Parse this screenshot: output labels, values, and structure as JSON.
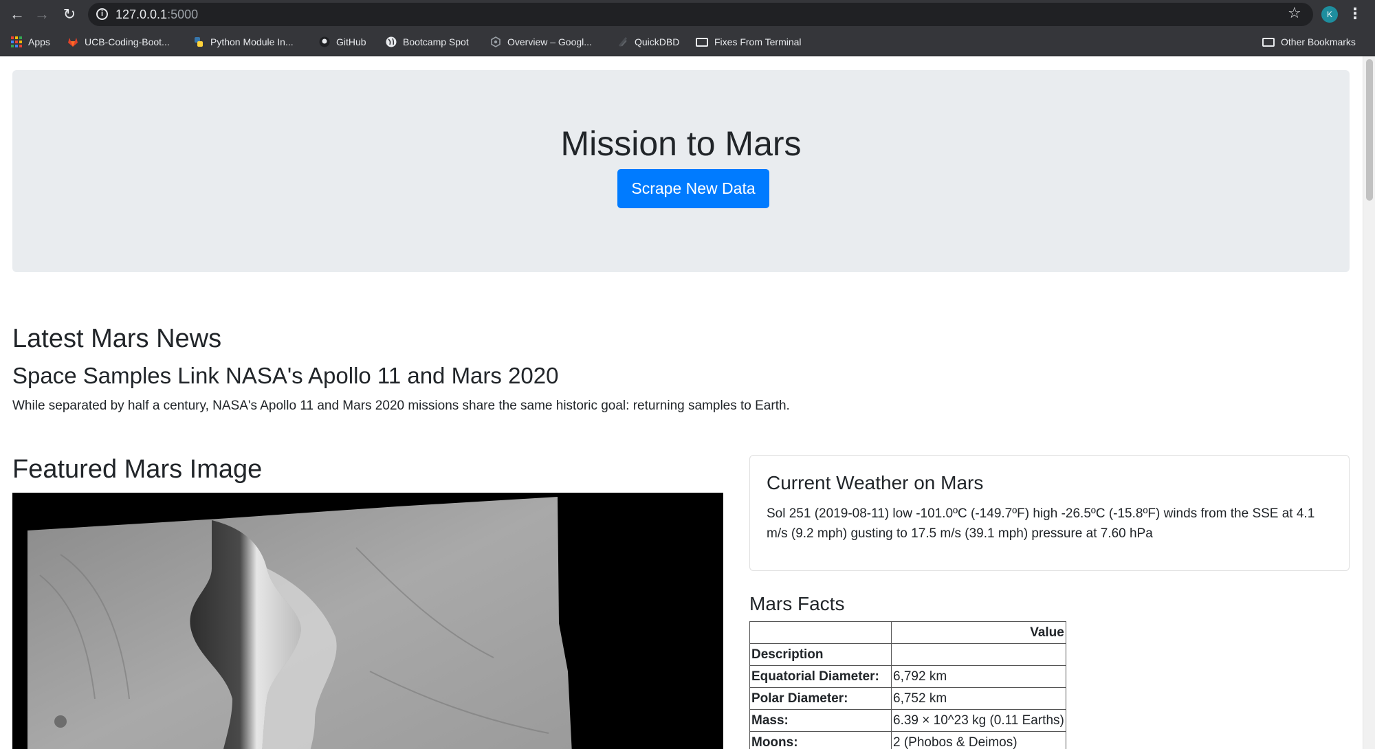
{
  "browser": {
    "url_host": "127.0.0.1",
    "url_port": ":5000",
    "avatar_initial": "K",
    "bookmarks": [
      {
        "label": "Apps",
        "icon": "apps-grid-icon"
      },
      {
        "label": "UCB-Coding-Boot...",
        "icon": "gitlab-icon"
      },
      {
        "label": "Python Module In...",
        "icon": "python-icon"
      },
      {
        "label": "GitHub",
        "icon": "github-icon"
      },
      {
        "label": "Bootcamp Spot",
        "icon": "globe-icon"
      },
      {
        "label": "Overview – Googl...",
        "icon": "google-cloud-icon"
      },
      {
        "label": "QuickDBD",
        "icon": "quickdbd-icon"
      },
      {
        "label": "Fixes From Terminal",
        "icon": "folder-icon"
      }
    ],
    "other_bookmarks": "Other Bookmarks"
  },
  "hero": {
    "title": "Mission to Mars",
    "button_label": "Scrape New Data",
    "button_color": "#007bff",
    "background_color": "#e9ecef"
  },
  "news": {
    "heading": "Latest Mars News",
    "title": "Space Samples Link NASA's Apollo 11 and Mars 2020",
    "teaser": "While separated by half a century, NASA's Apollo 11 and Mars 2020 missions share the same historic goal: returning samples to Earth."
  },
  "featured": {
    "heading": "Featured Mars Image"
  },
  "weather": {
    "heading": "Current Weather on Mars",
    "text": "Sol 251 (2019-08-11) low -101.0ºC (-149.7ºF) high -26.5ºC (-15.8ºF) winds from the SSE at 4.1 m/s (9.2 mph) gusting to 17.5 m/s (39.1 mph) pressure at 7.60 hPa"
  },
  "facts": {
    "heading": "Mars Facts",
    "header_col1": "",
    "header_col2": "Value",
    "index_label": "Description",
    "rows": [
      {
        "label": "Equatorial Diameter:",
        "value": "6,792 km"
      },
      {
        "label": "Polar Diameter:",
        "value": "6,752 km"
      },
      {
        "label": "Mass:",
        "value": "6.39 × 10^23 kg (0.11 Earths)"
      },
      {
        "label": "Moons:",
        "value": "2 (Phobos & Deimos)"
      }
    ]
  }
}
